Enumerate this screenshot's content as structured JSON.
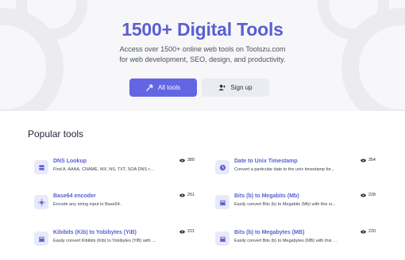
{
  "hero": {
    "title": "1500+ Digital Tools",
    "subtitle_line1": "Access over 1500+ online web tools on Toolszu.com",
    "subtitle_line2": "for web development, SEO, design, and productivity."
  },
  "buttons": {
    "all_tools": "All tools",
    "sign_up": "Sign up"
  },
  "section": {
    "title": "Popular tools"
  },
  "tools": [
    {
      "name": "DNS Lookup",
      "desc": "Find A, AAAA, CNAME, MX, NS, TXT, SOA DNS reco...",
      "views": "380",
      "icon": "server-icon"
    },
    {
      "name": "Date to Unix Timestamp",
      "desc": "Convert a particular date to the unix timestamp for...",
      "views": "354",
      "icon": "clock-icon"
    },
    {
      "name": "Base64 encoder",
      "desc": "Encode any string input to Base64.",
      "views": "251",
      "icon": "encode-icon"
    },
    {
      "name": "Bits (b) to Megabits (Mb)",
      "desc": "Easily convert Bits (b) to Megabits (Mb) with this si...",
      "views": "228",
      "icon": "calculator-icon"
    },
    {
      "name": "Kibibits (Kib) to Yobibytes (YiB)",
      "desc": "Easily convert Kibibits (Kib) to Yobibytes (YiB) with t...",
      "views": "221",
      "icon": "calculator-icon"
    },
    {
      "name": "Bits (b) to Megabytes (MB)",
      "desc": "Easily convert Bits (b) to Megabytes (MB) with this s...",
      "views": "220",
      "icon": "calculator-icon"
    }
  ],
  "colors": {
    "accent": "#5b5fd1",
    "button_primary": "#6366e3",
    "tile_bg": "#e8eafb"
  }
}
